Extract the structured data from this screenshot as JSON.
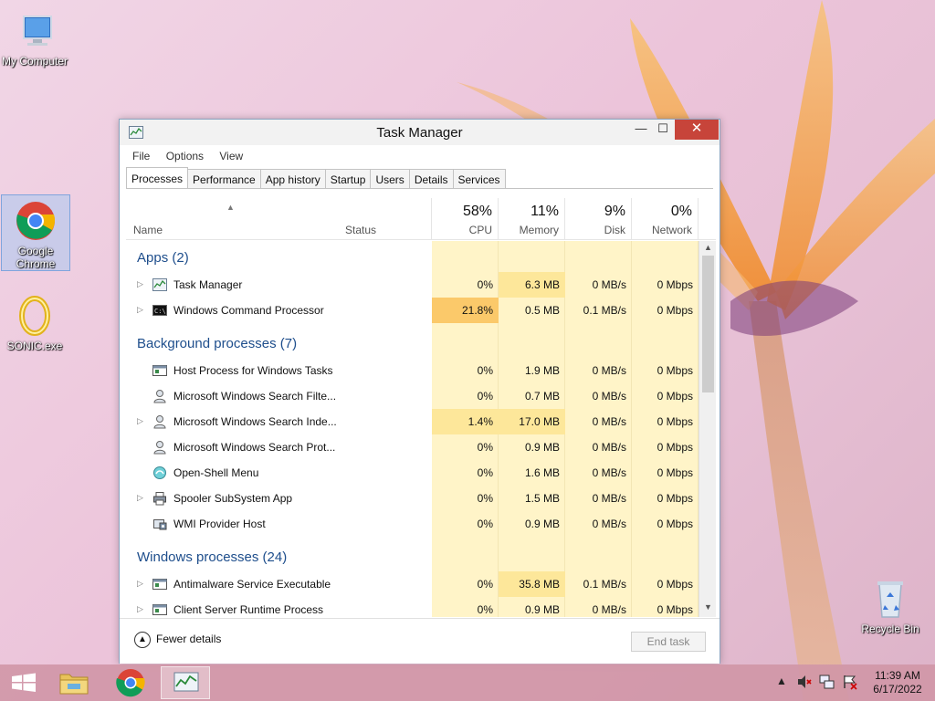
{
  "desktop": {
    "icons": [
      {
        "label": "My Computer"
      },
      {
        "label": "Google Chrome"
      },
      {
        "label": "SONIC.exe"
      },
      {
        "label": "Recycle Bin"
      }
    ]
  },
  "window": {
    "title": "Task Manager",
    "controls": {
      "minimize": "—",
      "maximize": "☐",
      "close": "✕"
    },
    "menu": [
      "File",
      "Options",
      "View"
    ],
    "tabs": [
      "Processes",
      "Performance",
      "App history",
      "Startup",
      "Users",
      "Details",
      "Services"
    ],
    "active_tab": "Processes",
    "columns": {
      "name": "Name",
      "status": "Status",
      "cpu": {
        "pct": "58%",
        "label": "CPU"
      },
      "memory": {
        "pct": "11%",
        "label": "Memory"
      },
      "disk": {
        "pct": "9%",
        "label": "Disk"
      },
      "network": {
        "pct": "0%",
        "label": "Network"
      }
    },
    "groups": {
      "apps": "Apps (2)",
      "background": "Background processes (7)",
      "windows": "Windows processes (24)"
    },
    "processes": {
      "task_manager": {
        "name": "Task Manager",
        "cpu": "0%",
        "mem": "6.3 MB",
        "disk": "0 MB/s",
        "net": "0 Mbps"
      },
      "cmd": {
        "name": "Windows Command Processor",
        "cpu": "21.8%",
        "mem": "0.5 MB",
        "disk": "0.1 MB/s",
        "net": "0 Mbps"
      },
      "host_process": {
        "name": "Host Process for Windows Tasks",
        "cpu": "0%",
        "mem": "1.9 MB",
        "disk": "0 MB/s",
        "net": "0 Mbps"
      },
      "search_filter": {
        "name": "Microsoft Windows Search Filte...",
        "cpu": "0%",
        "mem": "0.7 MB",
        "disk": "0 MB/s",
        "net": "0 Mbps"
      },
      "search_indexer": {
        "name": "Microsoft Windows Search Inde...",
        "cpu": "1.4%",
        "mem": "17.0 MB",
        "disk": "0 MB/s",
        "net": "0 Mbps"
      },
      "search_protocol": {
        "name": "Microsoft Windows Search Prot...",
        "cpu": "0%",
        "mem": "0.9 MB",
        "disk": "0 MB/s",
        "net": "0 Mbps"
      },
      "open_shell": {
        "name": "Open-Shell Menu",
        "cpu": "0%",
        "mem": "1.6 MB",
        "disk": "0 MB/s",
        "net": "0 Mbps"
      },
      "spooler": {
        "name": "Spooler SubSystem App",
        "cpu": "0%",
        "mem": "1.5 MB",
        "disk": "0 MB/s",
        "net": "0 Mbps"
      },
      "wmi": {
        "name": "WMI Provider Host",
        "cpu": "0%",
        "mem": "0.9 MB",
        "disk": "0 MB/s",
        "net": "0 Mbps"
      },
      "antimalware": {
        "name": "Antimalware Service Executable",
        "cpu": "0%",
        "mem": "35.8 MB",
        "disk": "0.1 MB/s",
        "net": "0 Mbps"
      },
      "csrss": {
        "name": "Client Server Runtime Process",
        "cpu": "0%",
        "mem": "0.9 MB",
        "disk": "0 MB/s",
        "net": "0 Mbps"
      }
    },
    "footer": {
      "fewer_details": "Fewer details",
      "end_task": "End task"
    }
  },
  "taskbar": {
    "clock": {
      "time": "11:39 AM",
      "date": "6/17/2022"
    },
    "tray_icons": [
      "chevron-up-icon",
      "volume-muted-icon",
      "network-icon",
      "flag-icon"
    ]
  },
  "colors": {
    "group_title": "#1e4e8c",
    "cpu_high": "#fbc96a",
    "cell_bg": "#fff4c8",
    "close_button": "#c7443a"
  }
}
